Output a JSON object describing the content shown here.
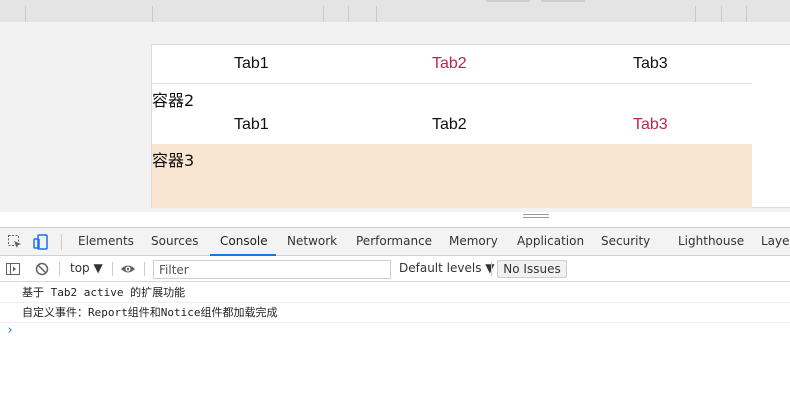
{
  "page": {
    "tabs_row1": [
      {
        "label": "Tab1",
        "active": false
      },
      {
        "label": "Tab2",
        "active": true
      },
      {
        "label": "Tab3",
        "active": false
      }
    ],
    "container2_label": "容器2",
    "tabs_row2": [
      {
        "label": "Tab1",
        "active": false
      },
      {
        "label": "Tab2",
        "active": false
      },
      {
        "label": "Tab3",
        "active": true
      }
    ],
    "container3_label": "容器3",
    "colors": {
      "active_tab": "#c0244a",
      "container3_bg": "#f8e6d3"
    }
  },
  "devtools": {
    "tabs": [
      "Elements",
      "Sources",
      "Console",
      "Network",
      "Performance",
      "Memory",
      "Application",
      "Security",
      "Lighthouse",
      "Layers"
    ],
    "active_tab": "Console",
    "icons": [
      "inspect-icon",
      "device-toggle-icon",
      "sidebar-toggle-icon",
      "clear-console-icon",
      "eye-icon"
    ],
    "context": "top ▼",
    "filter_placeholder": "Filter",
    "levels": "Default levels ▼",
    "issues": "No Issues",
    "logs": [
      "基于 Tab2 active 的扩展功能",
      "自定义事件：Report组件和Notice组件都加载完成"
    ],
    "prompt": "›",
    "accent": "#1a73e8"
  }
}
